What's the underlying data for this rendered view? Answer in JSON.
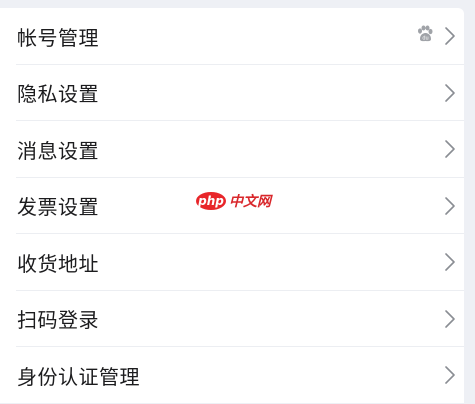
{
  "settings": {
    "items": [
      {
        "label": "帐号管理",
        "icon": "paw-icon"
      },
      {
        "label": "隐私设置"
      },
      {
        "label": "消息设置"
      },
      {
        "label": "发票设置"
      },
      {
        "label": "收货地址"
      },
      {
        "label": "扫码登录"
      },
      {
        "label": "身份认证管理"
      }
    ]
  },
  "watermark": {
    "badge": "php",
    "text": "中文网"
  },
  "colors": {
    "background": "#eef0f5",
    "panel": "#ffffff",
    "text": "#1c1c1e",
    "chevron": "#8a8d93",
    "watermark": "#e8262a"
  }
}
